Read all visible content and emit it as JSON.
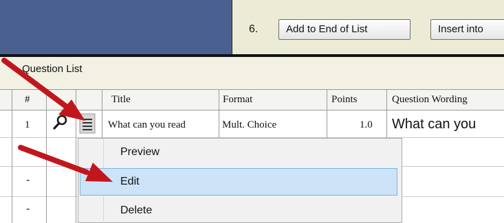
{
  "toolbar": {
    "step_number": "6.",
    "add_to_end_label": "Add to End of List",
    "insert_label": "Insert into"
  },
  "question_list": {
    "title": "Question List",
    "columns": [
      "#",
      "Title",
      "Format",
      "Points",
      "Question Wording"
    ],
    "rows": [
      {
        "number": "1",
        "title": "What can you read",
        "format": "Mult. Choice",
        "points": "1.0",
        "wording": "What can you"
      },
      {
        "number": "-"
      },
      {
        "number": "-"
      },
      {
        "number": "-"
      }
    ]
  },
  "context_menu": {
    "items": [
      "Preview",
      "Edit",
      "Delete"
    ],
    "highlighted": "Edit"
  },
  "colors": {
    "header_blue": "#4a6190",
    "arrow_red": "#c0171d",
    "menu_highlight": "#cde3f7"
  },
  "icons": [
    "magnifier-icon",
    "menu-lines-icon"
  ]
}
